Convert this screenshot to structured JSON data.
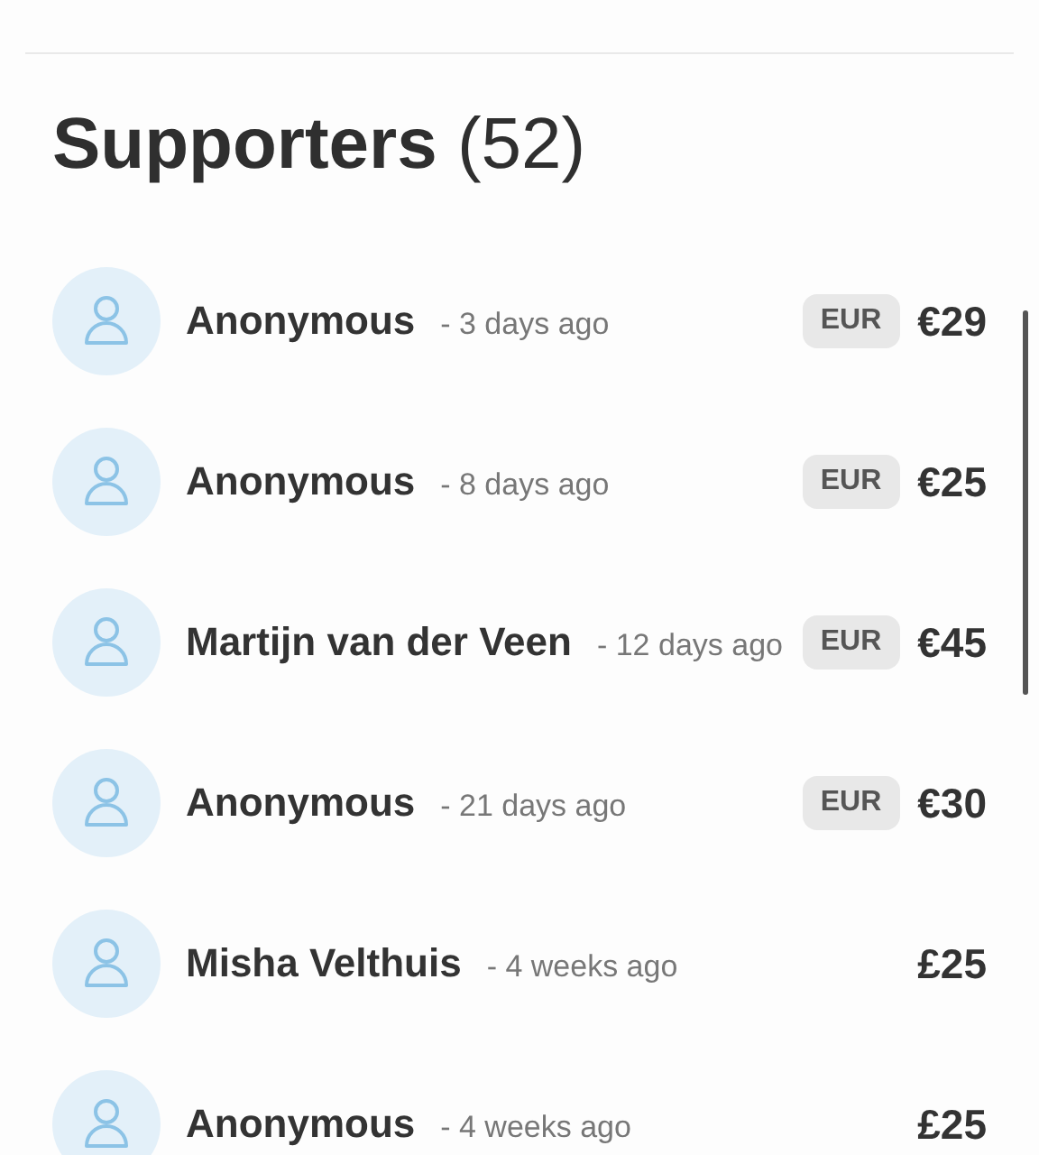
{
  "heading": {
    "title": "Supporters",
    "count": "(52)"
  },
  "supporters": [
    {
      "name": "Anonymous",
      "time": "- 3 days ago",
      "currency_badge": "EUR",
      "amount": "€29"
    },
    {
      "name": "Anonymous",
      "time": "- 8 days ago",
      "currency_badge": "EUR",
      "amount": "€25"
    },
    {
      "name": "Martijn van der Veen",
      "time": "- 12 days ago",
      "currency_badge": "EUR",
      "amount": "€45"
    },
    {
      "name": "Anonymous",
      "time": "- 21 days ago",
      "currency_badge": "EUR",
      "amount": "€30"
    },
    {
      "name": "Misha Velthuis",
      "time": "- 4 weeks ago",
      "amount": "£25"
    },
    {
      "name": "Anonymous",
      "time": "- 4 weeks ago",
      "amount": "£25"
    }
  ]
}
